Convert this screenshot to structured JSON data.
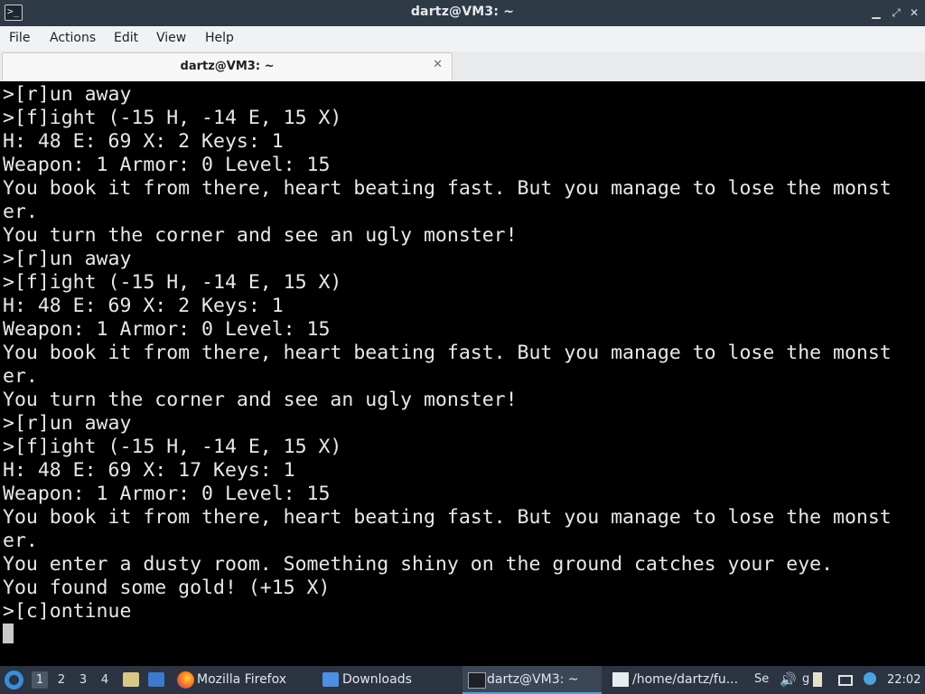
{
  "window": {
    "title": "dartz@VM3: ~",
    "controls": {
      "minimize": "▁",
      "maximize": "⤢",
      "close": "✕"
    }
  },
  "menu": [
    "File",
    "Actions",
    "Edit",
    "View",
    "Help"
  ],
  "tab": {
    "label": "dartz@VM3: ~",
    "close": "✕"
  },
  "terminal": {
    "lines": [
      ">[r]un away",
      ">[f]ight (-15 H, -14 E, 15 X)",
      "H: 48 E: 69 X: 2 Keys: 1",
      "Weapon: 1 Armor: 0 Level: 15",
      "You book it from there, heart beating fast. But you manage to lose the monst",
      "er.",
      "You turn the corner and see an ugly monster!",
      ">[r]un away",
      ">[f]ight (-15 H, -14 E, 15 X)",
      "H: 48 E: 69 X: 2 Keys: 1",
      "Weapon: 1 Armor: 0 Level: 15",
      "You book it from there, heart beating fast. But you manage to lose the monst",
      "er.",
      "You turn the corner and see an ugly monster!",
      ">[r]un away",
      ">[f]ight (-15 H, -14 E, 15 X)",
      "H: 48 E: 69 X: 17 Keys: 1",
      "Weapon: 1 Armor: 0 Level: 15",
      "You book it from there, heart beating fast. But you manage to lose the monst",
      "er.",
      "You enter a dusty room. Something shiny on the ground catches your eye.",
      "You found some gold! (+15 X)",
      ">[c]ontinue"
    ]
  },
  "taskbar": {
    "workspaces": [
      "1",
      "2",
      "3",
      "4"
    ],
    "active_workspace": "1",
    "tasks": [
      {
        "label": "Mozilla Firefox",
        "icon": "firefox-icon"
      },
      {
        "label": "Downloads",
        "icon": "folder-icon"
      },
      {
        "label": "dartz@VM3: ~",
        "icon": "terminal-icon"
      },
      {
        "label": "/home/dartz/fu...",
        "icon": "text-editor-icon"
      }
    ],
    "tray_text": [
      "Se",
      "g"
    ],
    "clock": "22:02"
  },
  "colors": {
    "titlebar_bg": "#2e3a46",
    "terminal_bg": "#000000",
    "terminal_fg": "#e8e8e8",
    "taskbar_bg": "#2b3440",
    "accent": "#5b9bd5"
  }
}
